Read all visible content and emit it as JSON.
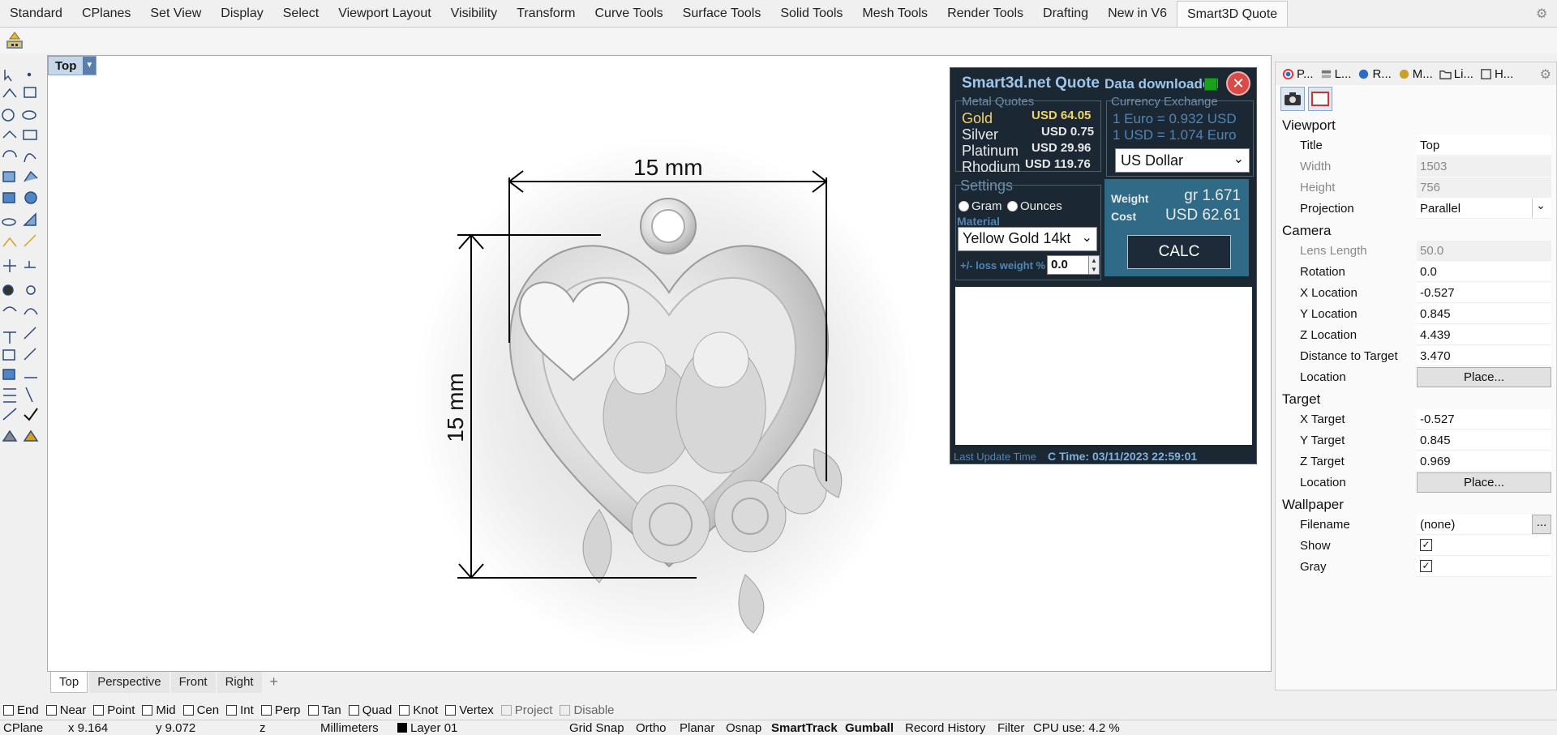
{
  "ribbon": {
    "tabs": [
      "Standard",
      "CPlanes",
      "Set View",
      "Display",
      "Select",
      "Viewport Layout",
      "Visibility",
      "Transform",
      "Curve Tools",
      "Surface Tools",
      "Solid Tools",
      "Mesh Tools",
      "Render Tools",
      "Drafting",
      "New in V6",
      "Smart3D Quote"
    ],
    "active": "Smart3D Quote"
  },
  "viewport": {
    "name": "Top",
    "dim_horizontal": "15 mm",
    "dim_vertical": "15 mm",
    "tabs": [
      "Top",
      "Perspective",
      "Front",
      "Right"
    ],
    "add_tab": "+"
  },
  "osnap": {
    "items": [
      "End",
      "Near",
      "Point",
      "Mid",
      "Cen",
      "Int",
      "Perp",
      "Tan",
      "Quad",
      "Knot",
      "Vertex",
      "Project",
      "Disable"
    ]
  },
  "status": {
    "cplane": "CPlane",
    "x": "x 9.164",
    "y": "y 9.072",
    "z": "z",
    "units": "Millimeters",
    "layer": "Layer 01",
    "grid_snap": "Grid Snap",
    "ortho": "Ortho",
    "planar": "Planar",
    "osnap": "Osnap",
    "smarttrack": "SmartTrack",
    "gumball": "Gumball",
    "record_history": "Record History",
    "filter": "Filter",
    "cpu": "CPU use: 4.2 %"
  },
  "smart3d": {
    "title": "Smart3d.net Quote",
    "download_status": "Data downloaded",
    "close": "✕",
    "metal_quotes_label": "Metal Quotes",
    "metals": [
      {
        "name": "Gold",
        "price": "USD 64.05"
      },
      {
        "name": "Silver",
        "price": "USD 0.75"
      },
      {
        "name": "Platinum",
        "price": "USD 29.96"
      },
      {
        "name": "Rhodium",
        "price": "USD 119.76"
      }
    ],
    "currency_label": "Currency Exchange",
    "euro_rate": "1 Euro = 0.932 USD",
    "usd_rate": "1 USD = 1.074 Euro",
    "currency_selected": "US Dollar",
    "settings_label": "Settings",
    "unit_gram": "Gram",
    "unit_ounces": "Ounces",
    "material_label": "Material",
    "material_selected": "Yellow Gold 14kt",
    "loss_label": "+/- loss weight %",
    "loss_value": "0.0",
    "weight_label": "Weight",
    "weight_value": "gr 1.671",
    "cost_label": "Cost",
    "cost_value": "USD 62.61",
    "calc_label": "CALC",
    "last_update_label": "Last Update Time",
    "last_update_value": "C Time: 03/11/2023 22:59:01"
  },
  "panel": {
    "tabs": [
      "P...",
      "L...",
      "R...",
      "M...",
      "Li...",
      "H..."
    ],
    "sections": {
      "viewport": "Viewport",
      "camera": "Camera",
      "target": "Target",
      "wallpaper": "Wallpaper"
    },
    "viewport_rows": [
      {
        "k": "Title",
        "v": "Top"
      },
      {
        "k": "Width",
        "v": "1503"
      },
      {
        "k": "Height",
        "v": "756"
      },
      {
        "k": "Projection",
        "v": "Parallel"
      }
    ],
    "camera_rows": [
      {
        "k": "Lens Length",
        "v": "50.0"
      },
      {
        "k": "Rotation",
        "v": "0.0"
      },
      {
        "k": "X Location",
        "v": "-0.527"
      },
      {
        "k": "Y Location",
        "v": "0.845"
      },
      {
        "k": "Z Location",
        "v": "4.439"
      },
      {
        "k": "Distance to Target",
        "v": "3.470"
      },
      {
        "k": "Location",
        "v": "Place..."
      }
    ],
    "target_rows": [
      {
        "k": "X Target",
        "v": "-0.527"
      },
      {
        "k": "Y Target",
        "v": "0.845"
      },
      {
        "k": "Z Target",
        "v": "0.969"
      },
      {
        "k": "Location",
        "v": "Place..."
      }
    ],
    "wallpaper_rows": [
      {
        "k": "Filename",
        "v": "(none)",
        "btn": "..."
      },
      {
        "k": "Show",
        "v": "✓"
      },
      {
        "k": "Gray",
        "v": "✓"
      }
    ]
  }
}
